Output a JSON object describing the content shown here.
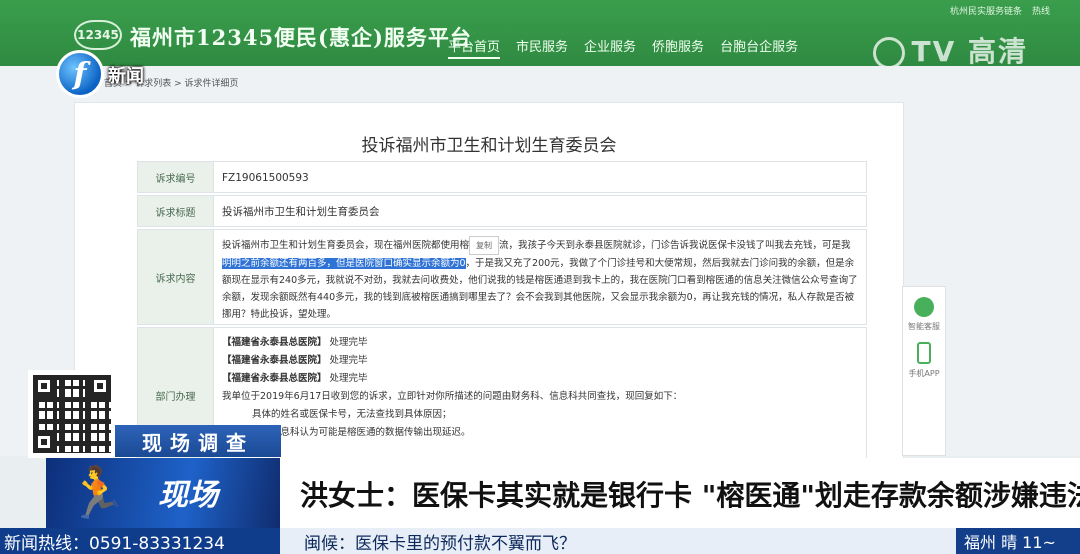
{
  "site": {
    "logo_text": "12345",
    "title": "福州市12345便民(惠企)服务平台",
    "nav": [
      "平台首页",
      "市民服务",
      "企业服务",
      "侨胞服务",
      "台胞台企服务"
    ],
    "top_util": [
      "杭州民实服务链条",
      "热线"
    ],
    "breadcrumb": "首页 > 诉求列表 > 诉求件详细页"
  },
  "tv": {
    "logo_glyph": "f",
    "logo_label": "新闻",
    "hd_watermark": "TV 高清"
  },
  "detail": {
    "title": "投诉福州市卫生和计划生育委员会",
    "rows": [
      {
        "label": "诉求编号",
        "value": "FZ19061500593"
      },
      {
        "label": "诉求标题",
        "value": "投诉福州市卫生和计划生育委员会"
      }
    ],
    "content_label": "诉求内容",
    "content_p1": "投诉福州市卫生和计划生育委员会，现在福州医院都使用榕",
    "copy_tip": "复制",
    "content_p2": "流，我孩子今天到永泰县医院就诊，门诊告诉我说医保卡没钱了叫我去充钱，可是我",
    "content_highlight": "明明之前余额还有两百多，但是医院窗口确实显示余额为0",
    "content_p3": "，于是我又充了200元，我做了个门诊挂号和大便常规，然后我就去门诊问我的余额，但是余额现在显示有240多元，我就说不对劲，我就去问收费处，他们说我的钱是榕医通退到我卡上的，我在医院门口看到榕医通的信息关注微信公众号查询了余额，发现余额既然有440多元，我的钱到底被榕医通搞到哪里去了？会不会我到其他医院，又会显示我余额为0，再让我充钱的情况，私人存款是否被挪用？特此投诉，望处理。",
    "dept_label": "部门办理",
    "dept_entries": [
      {
        "org": "【福建省永泰县总医院】",
        "status": "处理完毕"
      },
      {
        "org": "【福建省永泰县总医院】",
        "status": "处理完毕"
      },
      {
        "org": "【福建省永泰县总医院】",
        "status": "处理完毕"
      }
    ],
    "reply_1": "我单位于2019年6月17日收到您的诉求，立即针对你所描述的问题由财务科、信息科共同查找，现回复如下：",
    "reply_2": "具体的姓名或医保卡号，无法查找到具体原因；",
    "reply_3": "我院信息科认为可能是榕医通的数据传输出现延迟。"
  },
  "side_tools": [
    {
      "icon": "headset-icon",
      "label": "智能客服"
    },
    {
      "icon": "phone-icon",
      "label": "手机APP"
    }
  ],
  "broadcast": {
    "tag": "现场调查",
    "scene_glyph": "🏃",
    "scene_text": "现场",
    "headline": "洪女士：医保卡其实就是银行卡 \"榕医通\"划走存款余额涉嫌违法",
    "hotline": "新闻热线：0591-83331234",
    "ticker": "闽候：医保卡里的预付款不翼而飞？",
    "weather": "福州 晴 11~"
  },
  "colors": {
    "site_green": "#3a9e4d",
    "highlight_blue": "#2f73d6",
    "broadcast_blue": "#0f3d8c"
  }
}
